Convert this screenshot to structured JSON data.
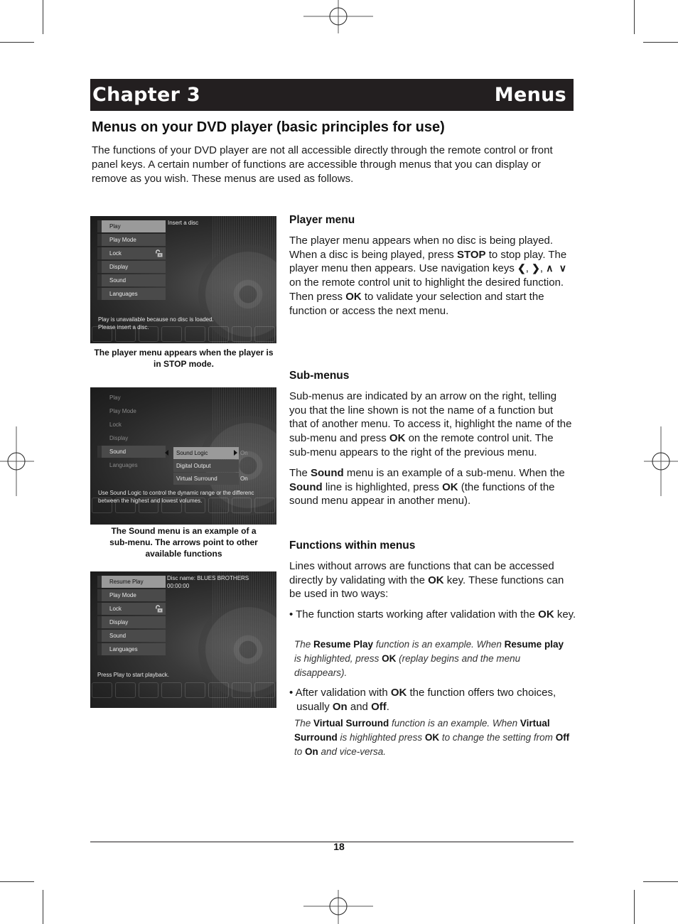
{
  "chapter": {
    "label": "Chapter 3",
    "title": "Menus"
  },
  "page_title": "Menus on your DVD player (basic principles for use)",
  "intro": "The functions of your DVD player are not all accessible directly through the remote control or front panel keys. A certain number of functions are accessible through menus that you can display or remove as you wish. These menus are used as follows.",
  "screens": {
    "player_menu": {
      "items": [
        "Play",
        "Play Mode",
        "Lock",
        "Display",
        "Sound",
        "Languages"
      ],
      "selected": "Play",
      "header": "Insert a disc",
      "message_line1": "Play is unavailable because no disc is loaded.",
      "message_line2": "Please insert a disc.",
      "caption": "The player menu appears when the player is in STOP mode."
    },
    "sound_menu": {
      "items": [
        "Play",
        "Play Mode",
        "Lock",
        "Display",
        "Sound",
        "Languages"
      ],
      "selected": "Sound",
      "submenu": [
        {
          "label": "Sound Logic",
          "value": "On"
        },
        {
          "label": "Digital Output",
          "value": ""
        },
        {
          "label": "Virtual Surround",
          "value": "On"
        }
      ],
      "message_line1": "Use Sound Logic to control the dynamic range or the differenc",
      "message_line2": "between the highest and lowest volumes.",
      "caption": "The Sound menu is an example of a sub-menu. The arrows point to other available functions"
    },
    "resume_menu": {
      "items": [
        "Resume Play",
        "Play Mode",
        "Lock",
        "Display",
        "Sound",
        "Languages"
      ],
      "selected": "Resume Play",
      "disc_name": "Disc name: BLUES BROTHERS",
      "time": "00:00:00",
      "message": "Press Play to start playback."
    }
  },
  "sections": {
    "player_menu": {
      "heading": "Player menu",
      "t1": "The player menu appears when no disc is being played. When a disc is being played, press ",
      "b1": "STOP",
      "t2": " to stop play. The player menu then appears. Use navigation keys ",
      "keys": [
        "⮜",
        "⮞",
        "⮝",
        "⮟"
      ],
      "t3": " on the remote control unit to highlight the desired function. Then press ",
      "b2": "OK",
      "t4": " to validate your selection and start the function or access the next menu."
    },
    "sub_menus": {
      "heading": "Sub-menus",
      "p1_t1": "Sub-menus are indicated by an arrow on the right, telling you that the line shown is not the name of a function but that of another menu. To access it, highlight the name of the sub-menu and press ",
      "p1_b1": "OK",
      "p1_t2": " on the remote control unit. The sub-menu appears to the right of the previous menu.",
      "p2_t1": "The ",
      "p2_b1": "Sound",
      "p2_t2": " menu is an example of a sub-menu. When the ",
      "p2_b2": "Sound",
      "p2_t3": " line is highlighted, press ",
      "p2_b3": "OK",
      "p2_t4": " (the functions of the sound menu appear in another menu)."
    },
    "functions": {
      "heading": "Functions within menus",
      "p_t1": "Lines without arrows are functions that can be accessed directly by validating with the ",
      "p_b1": "OK",
      "p_t2": " key. These functions can be used in two ways:",
      "bullet1_t1": "• The function starts working after validation with the ",
      "bullet1_b1": "OK",
      "bullet1_t2": " key.",
      "note1_t1": "The ",
      "note1_b1": "Resume Play",
      "note1_t2": " function is an example. When ",
      "note1_b2": "Resume play",
      "note1_t3": " is highlighted, press ",
      "note1_b3": "OK",
      "note1_t4": " (replay begins and the menu disappears).",
      "bullet2_t1": "• After validation with ",
      "bullet2_b1": "OK",
      "bullet2_t2": " the function offers two choices, usually ",
      "bullet2_b2": "On",
      "bullet2_t3": " and ",
      "bullet2_b3": "Off",
      "bullet2_t4": ".",
      "note2_t1": "The ",
      "note2_b1": "Virtual Surround",
      "note2_t2": " function is an example. When ",
      "note2_b2": "Virtual Surround",
      "note2_t3": " is highlighted press ",
      "note2_b3": "OK",
      "note2_t4": " to change the setting from ",
      "note2_b4": "Off",
      "note2_t5": " to ",
      "note2_b5": "On",
      "note2_t6": " and vice-versa."
    }
  },
  "page_number": "18"
}
